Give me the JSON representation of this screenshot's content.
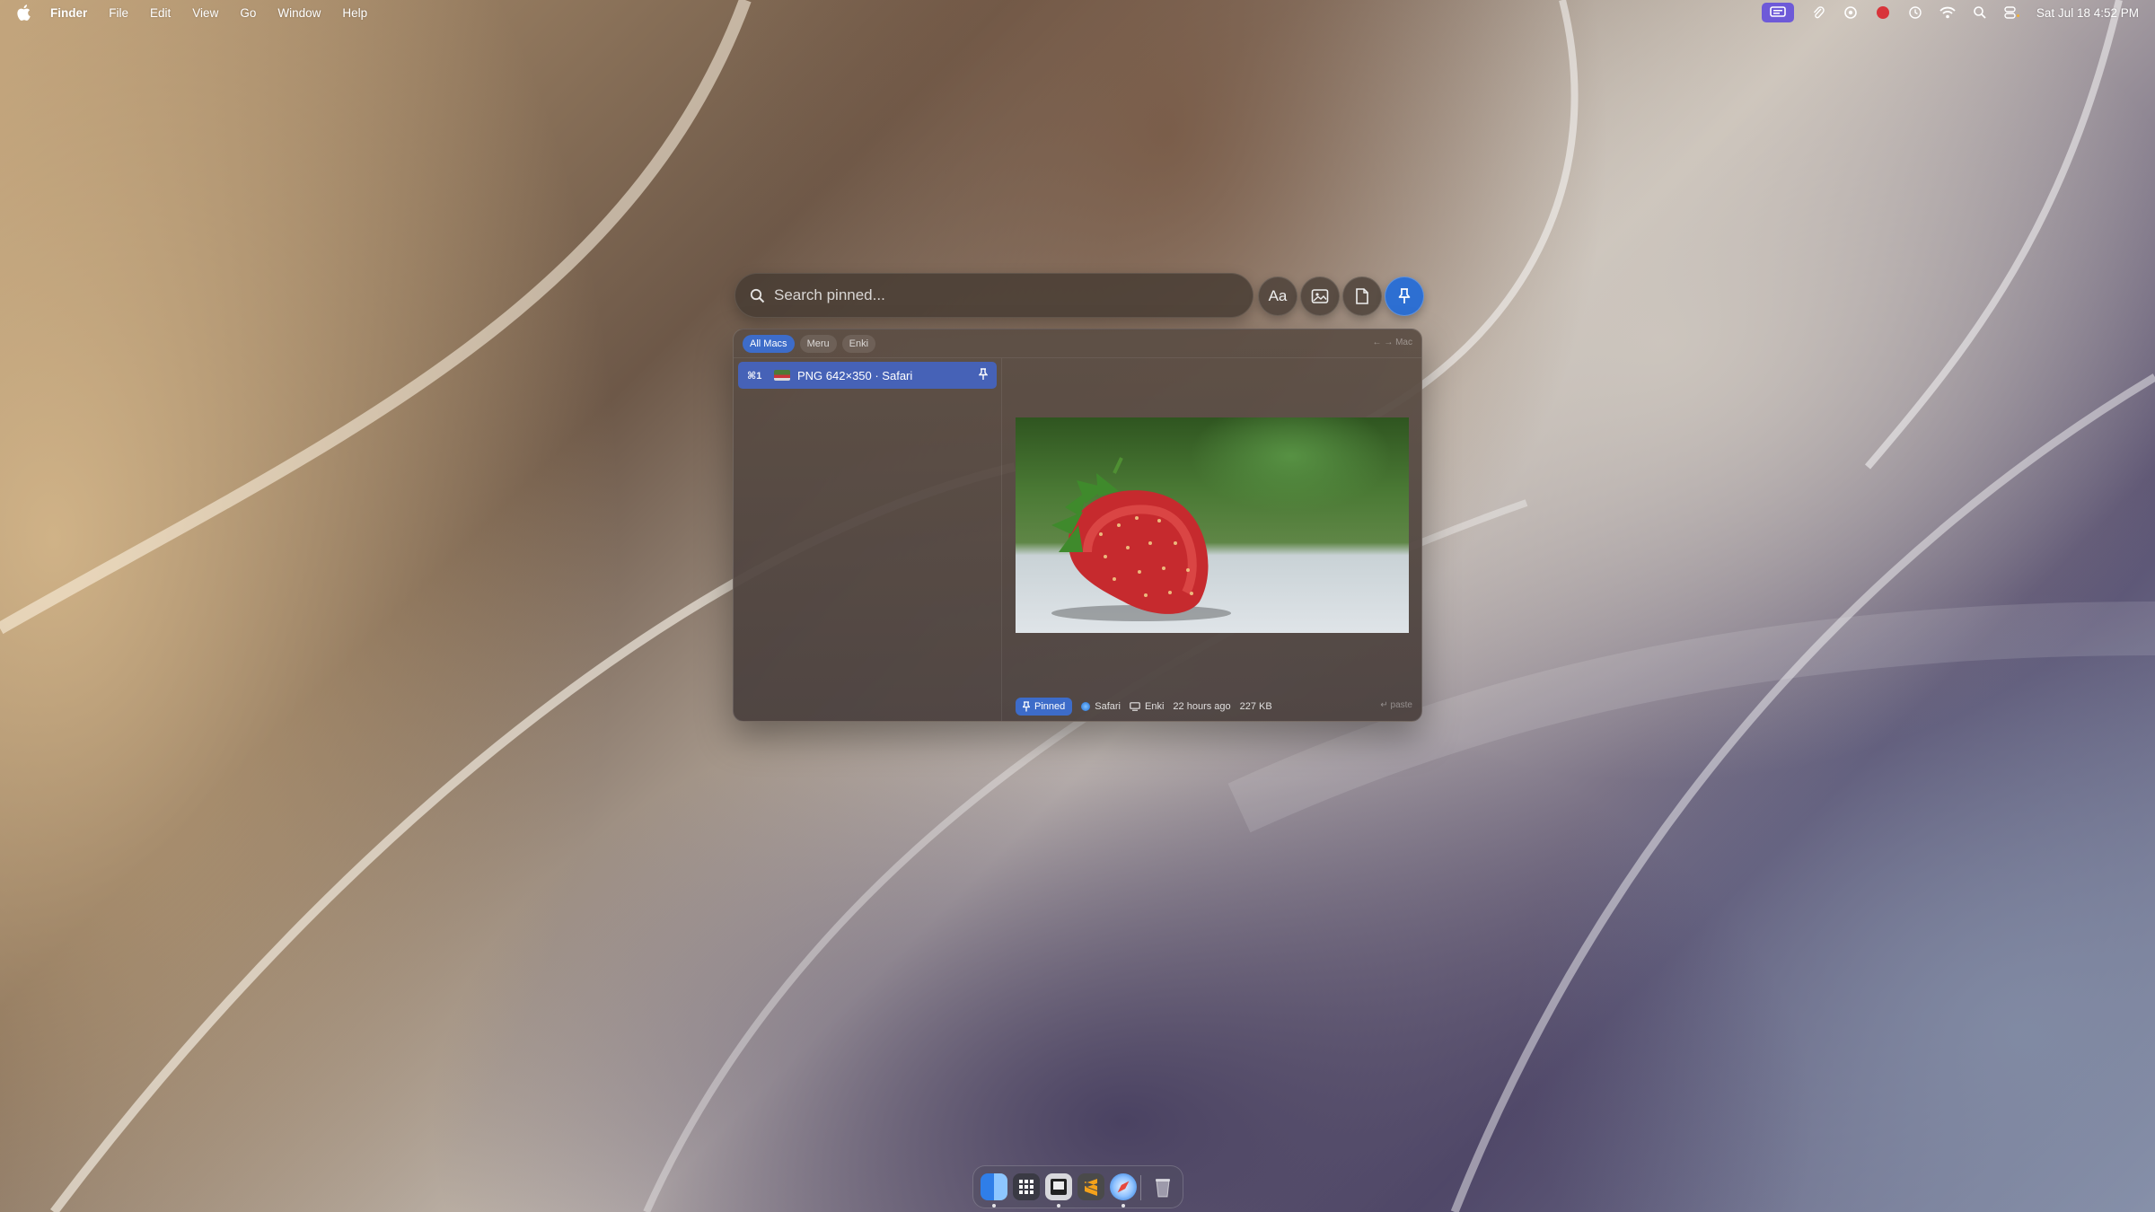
{
  "menubar": {
    "app_name": "Finder",
    "menus": [
      "File",
      "Edit",
      "View",
      "Go",
      "Window",
      "Help"
    ],
    "clock": "Sat Jul 18  4:52 PM",
    "status_icons": [
      "screen-mirror-icon",
      "paperclip-icon",
      "cloud-icon",
      "record-icon",
      "time-machine-icon",
      "wifi-icon",
      "spotlight-icon",
      "control-center-icon"
    ]
  },
  "search": {
    "placeholder": "Search pinned..."
  },
  "filters": [
    {
      "name": "text-filter",
      "label": "Aa"
    },
    {
      "name": "image-filter",
      "icon": "image-icon"
    },
    {
      "name": "file-filter",
      "icon": "document-icon"
    },
    {
      "name": "pinned-filter",
      "icon": "pin-icon",
      "active": true
    }
  ],
  "scopes": [
    "All Macs",
    "Meru",
    "Enki"
  ],
  "nav_hint": "← → Mac",
  "list": [
    {
      "shortcut": "⌘1",
      "title": "PNG 642×350 · Safari",
      "pinned": true
    }
  ],
  "footer": {
    "pinned_label": "Pinned",
    "app": "Safari",
    "device": "Enki",
    "time": "22 hours ago",
    "size": "227 KB",
    "paste_hint": "↵ paste"
  },
  "dock": {
    "apps": [
      "finder-icon",
      "launchpad-icon",
      "preview-icon",
      "sublime-text-icon",
      "safari-icon",
      "trash-icon"
    ]
  },
  "colors": {
    "accent": "#3d6cc9",
    "selection": "#4662b7",
    "pin_button": "#2d6fd2"
  }
}
